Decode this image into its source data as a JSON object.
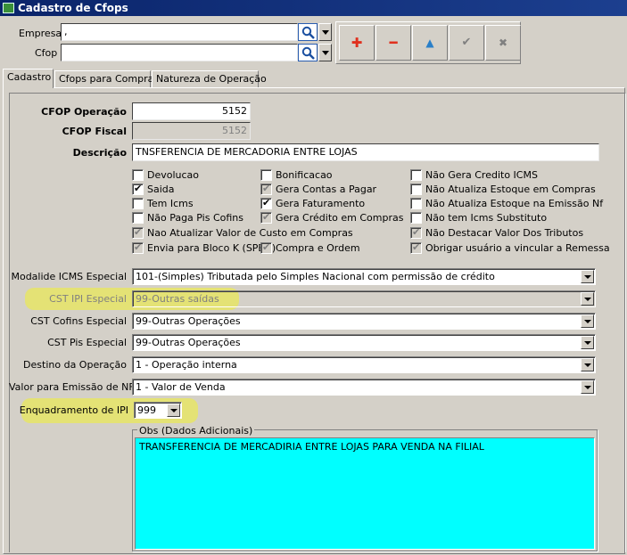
{
  "window": {
    "title": "Cadastro de Cfops"
  },
  "header": {
    "empresa_label": "Empresa",
    "empresa_value": ",",
    "cfop_label": "Cfop",
    "cfop_value": ""
  },
  "toolbar": {
    "add_glyph": "✚",
    "remove_glyph": "━",
    "up_glyph": "▲",
    "confirm_glyph": "✔",
    "cancel_glyph": "✖",
    "colors": {
      "add": "#e0301e",
      "remove": "#e0301e",
      "up": "#2a7fc8",
      "disabled": "#808080"
    }
  },
  "tabs": [
    {
      "label": "Cadastro"
    },
    {
      "label": "Cfops para Compras"
    },
    {
      "label": "Natureza de Operação"
    }
  ],
  "form": {
    "cfop_operacao_label": "CFOP Operação",
    "cfop_operacao_value": "5152",
    "cfop_fiscal_label": "CFOP Fiscal",
    "cfop_fiscal_value": "5152",
    "descricao_label": "Descrição",
    "descricao_value": "TNSFERENCIA DE MERCADORIA ENTRE LOJAS"
  },
  "checkboxes": {
    "col1": [
      {
        "label": "Devolucao",
        "checked": false,
        "disabled": false
      },
      {
        "label": "Saida",
        "checked": true,
        "disabled": false
      },
      {
        "label": "Tem Icms",
        "checked": false,
        "disabled": false
      },
      {
        "label": "Não Paga Pis Cofins",
        "checked": false,
        "disabled": false
      },
      {
        "label": "Nao Atualizar Valor de Custo em Compras",
        "checked": true,
        "disabled": true
      },
      {
        "label": "Envia para Bloco K (SPED)",
        "checked": true,
        "disabled": true
      }
    ],
    "col2": [
      {
        "label": "Bonificacao",
        "checked": false,
        "disabled": false
      },
      {
        "label": "Gera Contas a Pagar",
        "checked": true,
        "disabled": true
      },
      {
        "label": "Gera Faturamento",
        "checked": true,
        "disabled": false
      },
      {
        "label": "Gera Crédito em Compras",
        "checked": true,
        "disabled": true
      },
      {
        "label": "Compra e Ordem",
        "checked": true,
        "disabled": true
      }
    ],
    "col3": [
      {
        "label": "Não Gera Credito ICMS",
        "checked": false,
        "disabled": false
      },
      {
        "label": "Não Atualiza Estoque em Compras",
        "checked": false,
        "disabled": false
      },
      {
        "label": "Não Atualiza Estoque na Emissão Nf",
        "checked": false,
        "disabled": false
      },
      {
        "label": "Não tem Icms Substituto",
        "checked": false,
        "disabled": false
      },
      {
        "label": "Não Destacar Valor Dos Tributos",
        "checked": true,
        "disabled": true
      },
      {
        "label": "Obrigar usuário a vincular a Remessa",
        "checked": true,
        "disabled": true
      }
    ]
  },
  "selects": [
    {
      "label": "Modalide ICMS Especial",
      "value": "101-(Simples) Tributada pelo Simples Nacional com permissão de crédito"
    },
    {
      "label": "CST IPI Especial",
      "value": "99-Outras saídas"
    },
    {
      "label": "CST Cofins Especial",
      "value": "99-Outras Operações"
    },
    {
      "label": "CST Pis Especial",
      "value": "99-Outras Operações"
    },
    {
      "label": "Destino da Operação",
      "value": "1 - Operação interna"
    },
    {
      "label": "Valor para Emissão de NF",
      "value": "1 - Valor de Venda"
    }
  ],
  "enquadramento": {
    "label": "Enquadramento de IPI",
    "value": "999"
  },
  "obs": {
    "legend": "Obs (Dados Adicionais)",
    "text": "TRANSFERENCIA DE MERCADIRIA ENTRE LOJAS PARA VENDA NA FILIAL"
  },
  "highlight_color": "#f0f032"
}
